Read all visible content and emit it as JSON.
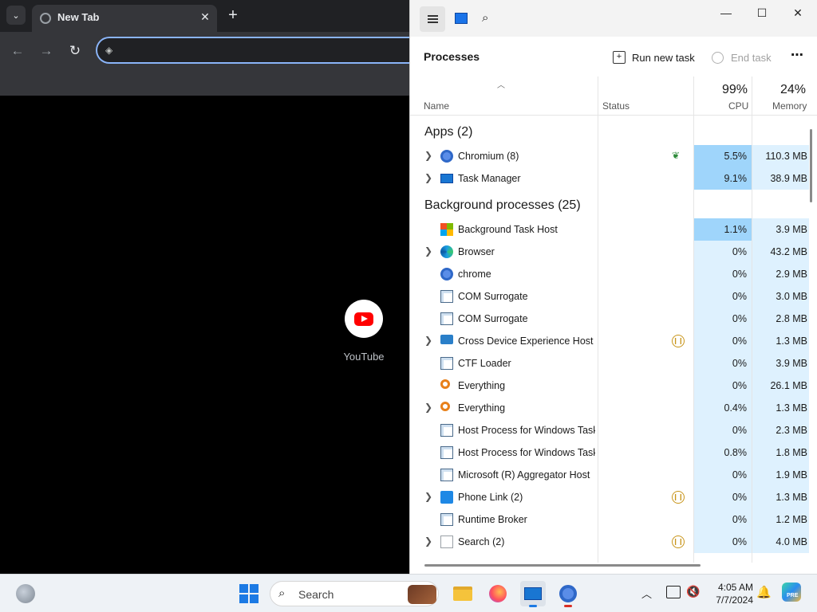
{
  "browser": {
    "tab_title": "New Tab",
    "tab_search_glyph": "⌄",
    "close_glyph": "✕",
    "new_tab_glyph": "+",
    "back_glyph": "←",
    "forward_glyph": "→",
    "reload_glyph": "↻",
    "omnibox_value": "",
    "shortcut_label": "YouTube",
    "colors": {
      "frame": "#202124",
      "toolbar": "#35363a",
      "focus_ring": "#8ab4f8"
    }
  },
  "task_manager": {
    "section_title": "Processes",
    "run_new_task": "Run new task",
    "end_task": "End task",
    "more_glyph": "⋯",
    "minimize_glyph": "—",
    "maximize_glyph": "☐",
    "close_glyph": "✕",
    "columns": {
      "name": "Name",
      "status": "Status",
      "cpu_pct": "99%",
      "cpu": "CPU",
      "mem_pct": "24%",
      "memory": "Memory"
    },
    "groups": {
      "apps": "Apps (2)",
      "background": "Background processes (25)"
    },
    "apps": [
      {
        "name": "Chromium (8)",
        "icon": "chromium-icon",
        "expandable": true,
        "status": "efficiency-leaf",
        "cpu": "5.5%",
        "mem": "110.3 MB",
        "heat": "hi"
      },
      {
        "name": "Task Manager",
        "icon": "task-manager-icon",
        "expandable": true,
        "status": "",
        "cpu": "9.1%",
        "mem": "38.9 MB",
        "heat": "hi"
      }
    ],
    "background": [
      {
        "name": "Background Task Host",
        "icon": "windows-logo-icon",
        "expandable": false,
        "status": "",
        "cpu": "1.1%",
        "mem": "3.9 MB",
        "heat": "hi"
      },
      {
        "name": "Browser",
        "icon": "edge-icon",
        "expandable": true,
        "status": "",
        "cpu": "0%",
        "mem": "43.2 MB",
        "heat": "lo"
      },
      {
        "name": "chrome",
        "icon": "chromium-icon",
        "expandable": false,
        "status": "",
        "cpu": "0%",
        "mem": "2.9 MB",
        "heat": "lo"
      },
      {
        "name": "COM Surrogate",
        "icon": "window-frame-icon",
        "expandable": false,
        "status": "",
        "cpu": "0%",
        "mem": "3.0 MB",
        "heat": "lo"
      },
      {
        "name": "COM Surrogate",
        "icon": "window-frame-icon",
        "expandable": false,
        "status": "",
        "cpu": "0%",
        "mem": "2.8 MB",
        "heat": "lo"
      },
      {
        "name": "Cross Device Experience Host ...",
        "icon": "monitor-icon",
        "expandable": true,
        "status": "suspended",
        "cpu": "0%",
        "mem": "1.3 MB",
        "heat": "lo"
      },
      {
        "name": "CTF Loader",
        "icon": "window-frame-icon",
        "expandable": false,
        "status": "",
        "cpu": "0%",
        "mem": "3.9 MB",
        "heat": "lo"
      },
      {
        "name": "Everything",
        "icon": "magnifier-orange-icon",
        "expandable": false,
        "status": "",
        "cpu": "0%",
        "mem": "26.1 MB",
        "heat": "lo"
      },
      {
        "name": "Everything",
        "icon": "magnifier-orange-icon",
        "expandable": true,
        "status": "",
        "cpu": "0.4%",
        "mem": "1.3 MB",
        "heat": "lo"
      },
      {
        "name": "Host Process for Windows Tasks",
        "icon": "window-frame-icon",
        "expandable": false,
        "status": "",
        "cpu": "0%",
        "mem": "2.3 MB",
        "heat": "lo"
      },
      {
        "name": "Host Process for Windows Tasks",
        "icon": "window-frame-icon",
        "expandable": false,
        "status": "",
        "cpu": "0.8%",
        "mem": "1.8 MB",
        "heat": "lo"
      },
      {
        "name": "Microsoft (R) Aggregator Host",
        "icon": "window-frame-icon",
        "expandable": false,
        "status": "",
        "cpu": "0%",
        "mem": "1.9 MB",
        "heat": "lo"
      },
      {
        "name": "Phone Link (2)",
        "icon": "phone-link-icon",
        "expandable": true,
        "status": "suspended",
        "cpu": "0%",
        "mem": "1.3 MB",
        "heat": "lo"
      },
      {
        "name": "Runtime Broker",
        "icon": "window-frame-icon",
        "expandable": false,
        "status": "",
        "cpu": "0%",
        "mem": "1.2 MB",
        "heat": "lo"
      },
      {
        "name": "Search (2)",
        "icon": "search-app-icon",
        "expandable": true,
        "status": "suspended",
        "cpu": "0%",
        "mem": "4.0 MB",
        "heat": "lo"
      }
    ],
    "colors": {
      "heat_low": "#def1fe",
      "heat_high": "#9fd5fb",
      "suspended": "#c8951a",
      "efficiency": "#2e8b3a"
    }
  },
  "taskbar": {
    "search_placeholder": "Search",
    "time": "4:05 AM",
    "date": "7/7/2024",
    "copilot_badge": "PRE",
    "apps": [
      "file-explorer-icon",
      "firefox-icon",
      "task-manager-icon",
      "chromium-icon"
    ]
  }
}
